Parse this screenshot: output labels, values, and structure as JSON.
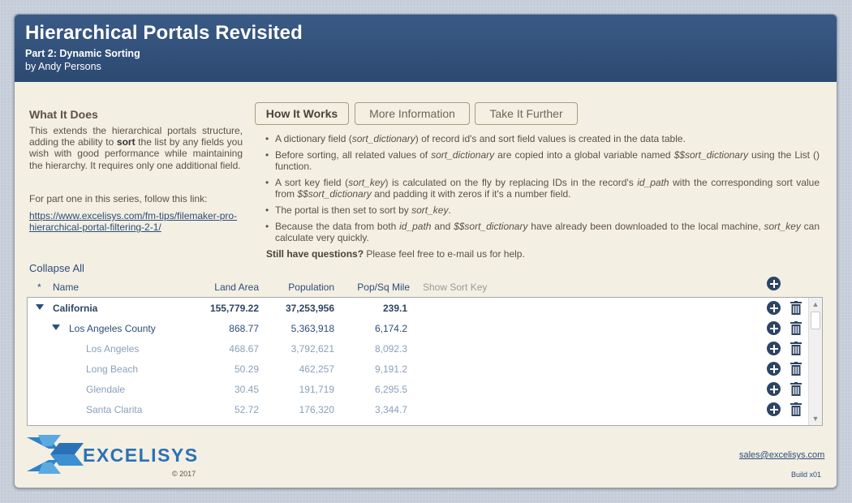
{
  "header": {
    "title": "Hierarchical Portals Revisited",
    "subtitle": "Part 2: Dynamic Sorting",
    "byline": "by Andy Persons"
  },
  "what_it_does": {
    "heading": "What It Does",
    "body_prefix": "This extends the hierarchical portals structure, adding the ability to ",
    "body_bold": "sort",
    "body_suffix": " the list by any fields you wish with good performance while maintaining the hierarchy. It requires only one additional field.",
    "part_one_text": "For part one in this series, follow this link:",
    "part_one_link": "https://www.excelisys.com/fm-tips/filemaker-pro-hierarchical-portal-filtering-2-1/"
  },
  "tabs": [
    {
      "label": "How It Works",
      "active": true
    },
    {
      "label": "More Information",
      "active": false
    },
    {
      "label": "Take It Further",
      "active": false
    }
  ],
  "how_it_works": {
    "b1_a": "A dictionary field (",
    "b1_i": "sort_dictionary",
    "b1_b": ") of record id's and sort field values is created in the data table.",
    "b2_a": "Before sorting, all related values of ",
    "b2_i1": "sort_dictionary",
    "b2_b": " are copied into a global variable named ",
    "b2_i2": "$$sort_dictionary",
    "b2_c": " using the List () function.",
    "b3_a": "A sort key field (",
    "b3_i1": "sort_key",
    "b3_b": ") is calculated on the fly by replacing IDs in the record's ",
    "b3_i2": "id_path",
    "b3_c": " with the corresponding sort value from ",
    "b3_i3": "$$sort_dictionary",
    "b3_d": " and padding it with zeros if it's a number field.",
    "b4_a": "The portal is then set to sort by ",
    "b4_i": "sort_key",
    "b4_b": ".",
    "b5_a": "Because the data from both ",
    "b5_i1": "id_path",
    "b5_b": " and ",
    "b5_i2": "$$sort_dictionary",
    "b5_c": " have already been downloaded to the local machine, ",
    "b5_i3": "sort_key",
    "b5_d": " can calculate very quickly.",
    "still_bold": "Still have questions?",
    "still_rest": " Please feel free to e-mail us for help."
  },
  "portal": {
    "collapse_all": "Collapse All",
    "columns": {
      "star": "*",
      "name": "Name",
      "land": "Land Area",
      "population": "Population",
      "density": "Pop/Sq Mile",
      "show_sort_key": "Show Sort Key"
    },
    "rows": [
      {
        "level": 0,
        "expanded": true,
        "name": "California",
        "land": "155,779.22",
        "population": "37,253,956",
        "density": "239.1"
      },
      {
        "level": 1,
        "expanded": true,
        "name": "Los Angeles County",
        "land": "868.77",
        "population": "5,363,918",
        "density": "6,174.2"
      },
      {
        "level": 2,
        "expanded": false,
        "name": "Los Angeles",
        "land": "468.67",
        "population": "3,792,621",
        "density": "8,092.3"
      },
      {
        "level": 2,
        "expanded": false,
        "name": "Long Beach",
        "land": "50.29",
        "population": "462,257",
        "density": "9,191.2"
      },
      {
        "level": 2,
        "expanded": false,
        "name": "Glendale",
        "land": "30.45",
        "population": "191,719",
        "density": "6,295.5"
      },
      {
        "level": 2,
        "expanded": false,
        "name": "Santa Clarita",
        "land": "52.72",
        "population": "176,320",
        "density": "3,344.7"
      }
    ]
  },
  "footer": {
    "logo_text": "EXCELISYS",
    "copyright": "© 2017",
    "email": "sales@excelisys.com",
    "build": "Build x01"
  },
  "colors": {
    "header_bg": "#2f4d77",
    "panel_bg": "#f4efe3",
    "link": "#2c4d78",
    "logo_blue": "#2a72b5"
  },
  "icons": [
    "add-circle-icon",
    "trash-icon",
    "disclosure-triangle-icon",
    "scroll-up-icon",
    "scroll-down-icon"
  ]
}
